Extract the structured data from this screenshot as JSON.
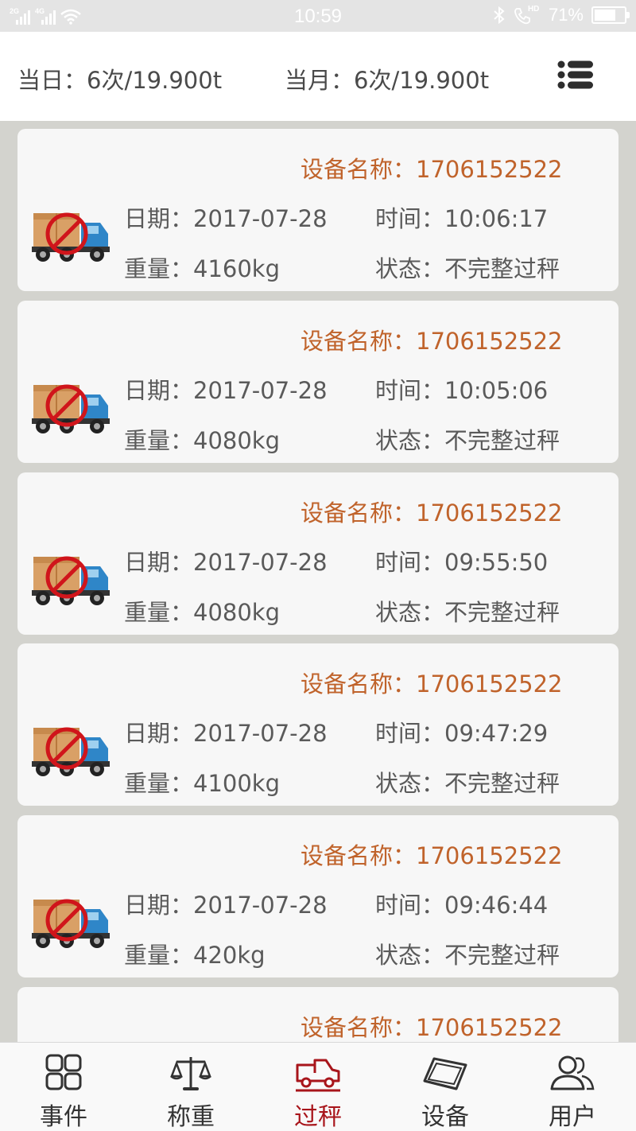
{
  "status_bar": {
    "sim1_label": "2G",
    "sim2_label": "4G",
    "time": "10:59",
    "hd_label": "HD",
    "battery_text": "71%",
    "battery_level": 0.71
  },
  "summary": {
    "day_text": "当日：6次/19.900t",
    "month_text": "当月：6次/19.900t"
  },
  "records": [
    {
      "device": "设备名称：1706152522",
      "date": "日期：2017-07-28",
      "time": "时间：10:06:17",
      "weight": "重量：4160kg",
      "status": "状态：不完整过秤"
    },
    {
      "device": "设备名称：1706152522",
      "date": "日期：2017-07-28",
      "time": "时间：10:05:06",
      "weight": "重量：4080kg",
      "status": "状态：不完整过秤"
    },
    {
      "device": "设备名称：1706152522",
      "date": "日期：2017-07-28",
      "time": "时间：09:55:50",
      "weight": "重量：4080kg",
      "status": "状态：不完整过秤"
    },
    {
      "device": "设备名称：1706152522",
      "date": "日期：2017-07-28",
      "time": "时间：09:47:29",
      "weight": "重量：4100kg",
      "status": "状态：不完整过秤"
    },
    {
      "device": "设备名称：1706152522",
      "date": "日期：2017-07-28",
      "time": "时间：09:46:44",
      "weight": "重量：420kg",
      "status": "状态：不完整过秤"
    },
    {
      "device": "设备名称：1706152522",
      "date": "",
      "time": "",
      "weight": "",
      "status": ""
    }
  ],
  "tabs": [
    {
      "label": "事件",
      "icon": "grid-icon"
    },
    {
      "label": "称重",
      "icon": "scale-icon"
    },
    {
      "label": "过秤",
      "icon": "truck-icon",
      "active": true
    },
    {
      "label": "设备",
      "icon": "device-icon"
    },
    {
      "label": "用户",
      "icon": "users-icon"
    }
  ],
  "colors": {
    "accent": "#a8151b",
    "device_text": "#c0632b",
    "background": "#d3d3ce",
    "card": "#f7f7f7"
  }
}
